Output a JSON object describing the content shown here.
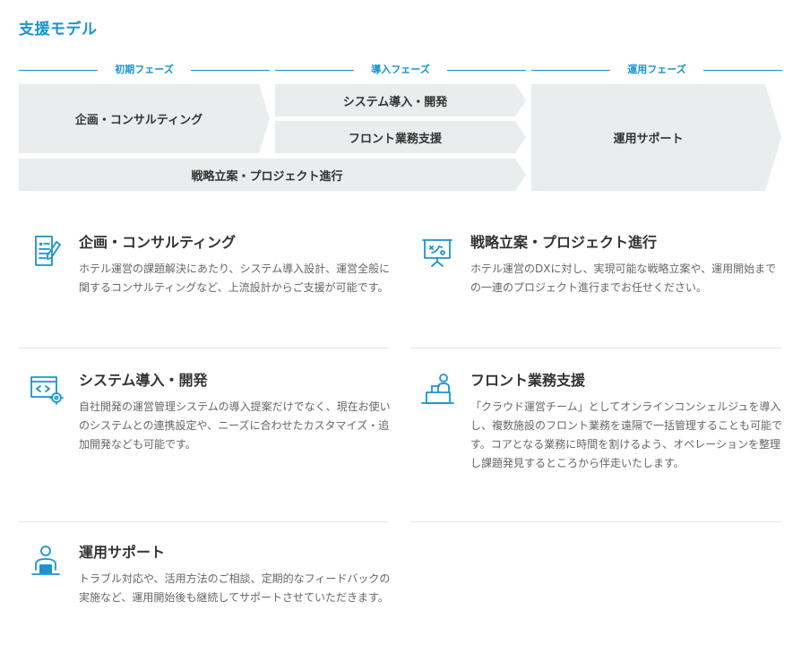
{
  "title": "支援モデル",
  "phases": {
    "initial": "初期フェーズ",
    "implementation": "導入フェーズ",
    "operation": "運用フェーズ"
  },
  "flow": {
    "planning": "企画・コンサルティング",
    "system": "システム導入・開発",
    "front": "フロント業務支援",
    "strategy": "戦略立案・プロジェクト進行",
    "support": "運用サポート"
  },
  "cards": {
    "planning": {
      "title": "企画・コンサルティング",
      "desc": "ホテル運営の課題解決にあたり、システム導入設計、運営全般に関するコンサルティングなど、上流設計からご支援が可能です。",
      "icon": "document-pen-icon"
    },
    "strategy": {
      "title": "戦略立案・プロジェクト進行",
      "desc": "ホテル運営のDXに対し、実現可能な戦略立案や、運用開始までの一連のプロジェクト進行までお任せください。",
      "icon": "presentation-board-icon"
    },
    "system": {
      "title": "システム導入・開発",
      "desc": "自社開発の運営管理システムの導入提案だけでなく、現在お使いのシステムとの連携設定や、ニーズに合わせたカスタマイズ・追加開発なども可能です。",
      "icon": "code-window-gear-icon"
    },
    "front": {
      "title": "フロント業務支援",
      "desc": "「クラウド運営チーム」としてオンラインコンシェルジュを導入し、複数施設のフロント業務を遠隔で一括管理することも可能です。コアとなる業務に時間を割けるよう、オペレーションを整理し課題発見するところから伴走いたします。",
      "icon": "front-desk-person-icon"
    },
    "support": {
      "title": "運用サポート",
      "desc": "トラブル対応や、活用方法のご相談、定期的なフィードバックの実施など、運用開始後も継続してサポートさせていただきます。",
      "icon": "operator-laptop-icon"
    }
  },
  "colors": {
    "accent": "#1a93cf",
    "box": "#e9edee",
    "text": "#333333",
    "muted": "#666666"
  }
}
